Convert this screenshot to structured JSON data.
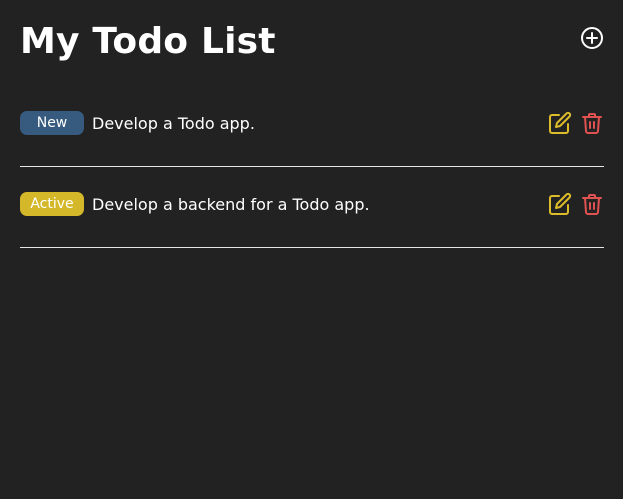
{
  "app": {
    "title": "My Todo List",
    "add_icon": "plus-circle-icon"
  },
  "colors": {
    "background": "#222222",
    "status_new": "#375a7f",
    "status_active": "#d4b82a",
    "edit": "#dcbc2a",
    "delete": "#e05252"
  },
  "todos": [
    {
      "status": "New",
      "text": "Develop a Todo app.",
      "status_color": "#375a7f",
      "edit_icon": "edit-icon",
      "delete_icon": "trash-icon"
    },
    {
      "status": "Active",
      "text": "Develop a backend for a Todo app.",
      "status_color": "#d4b82a",
      "edit_icon": "edit-icon",
      "delete_icon": "trash-icon"
    }
  ]
}
